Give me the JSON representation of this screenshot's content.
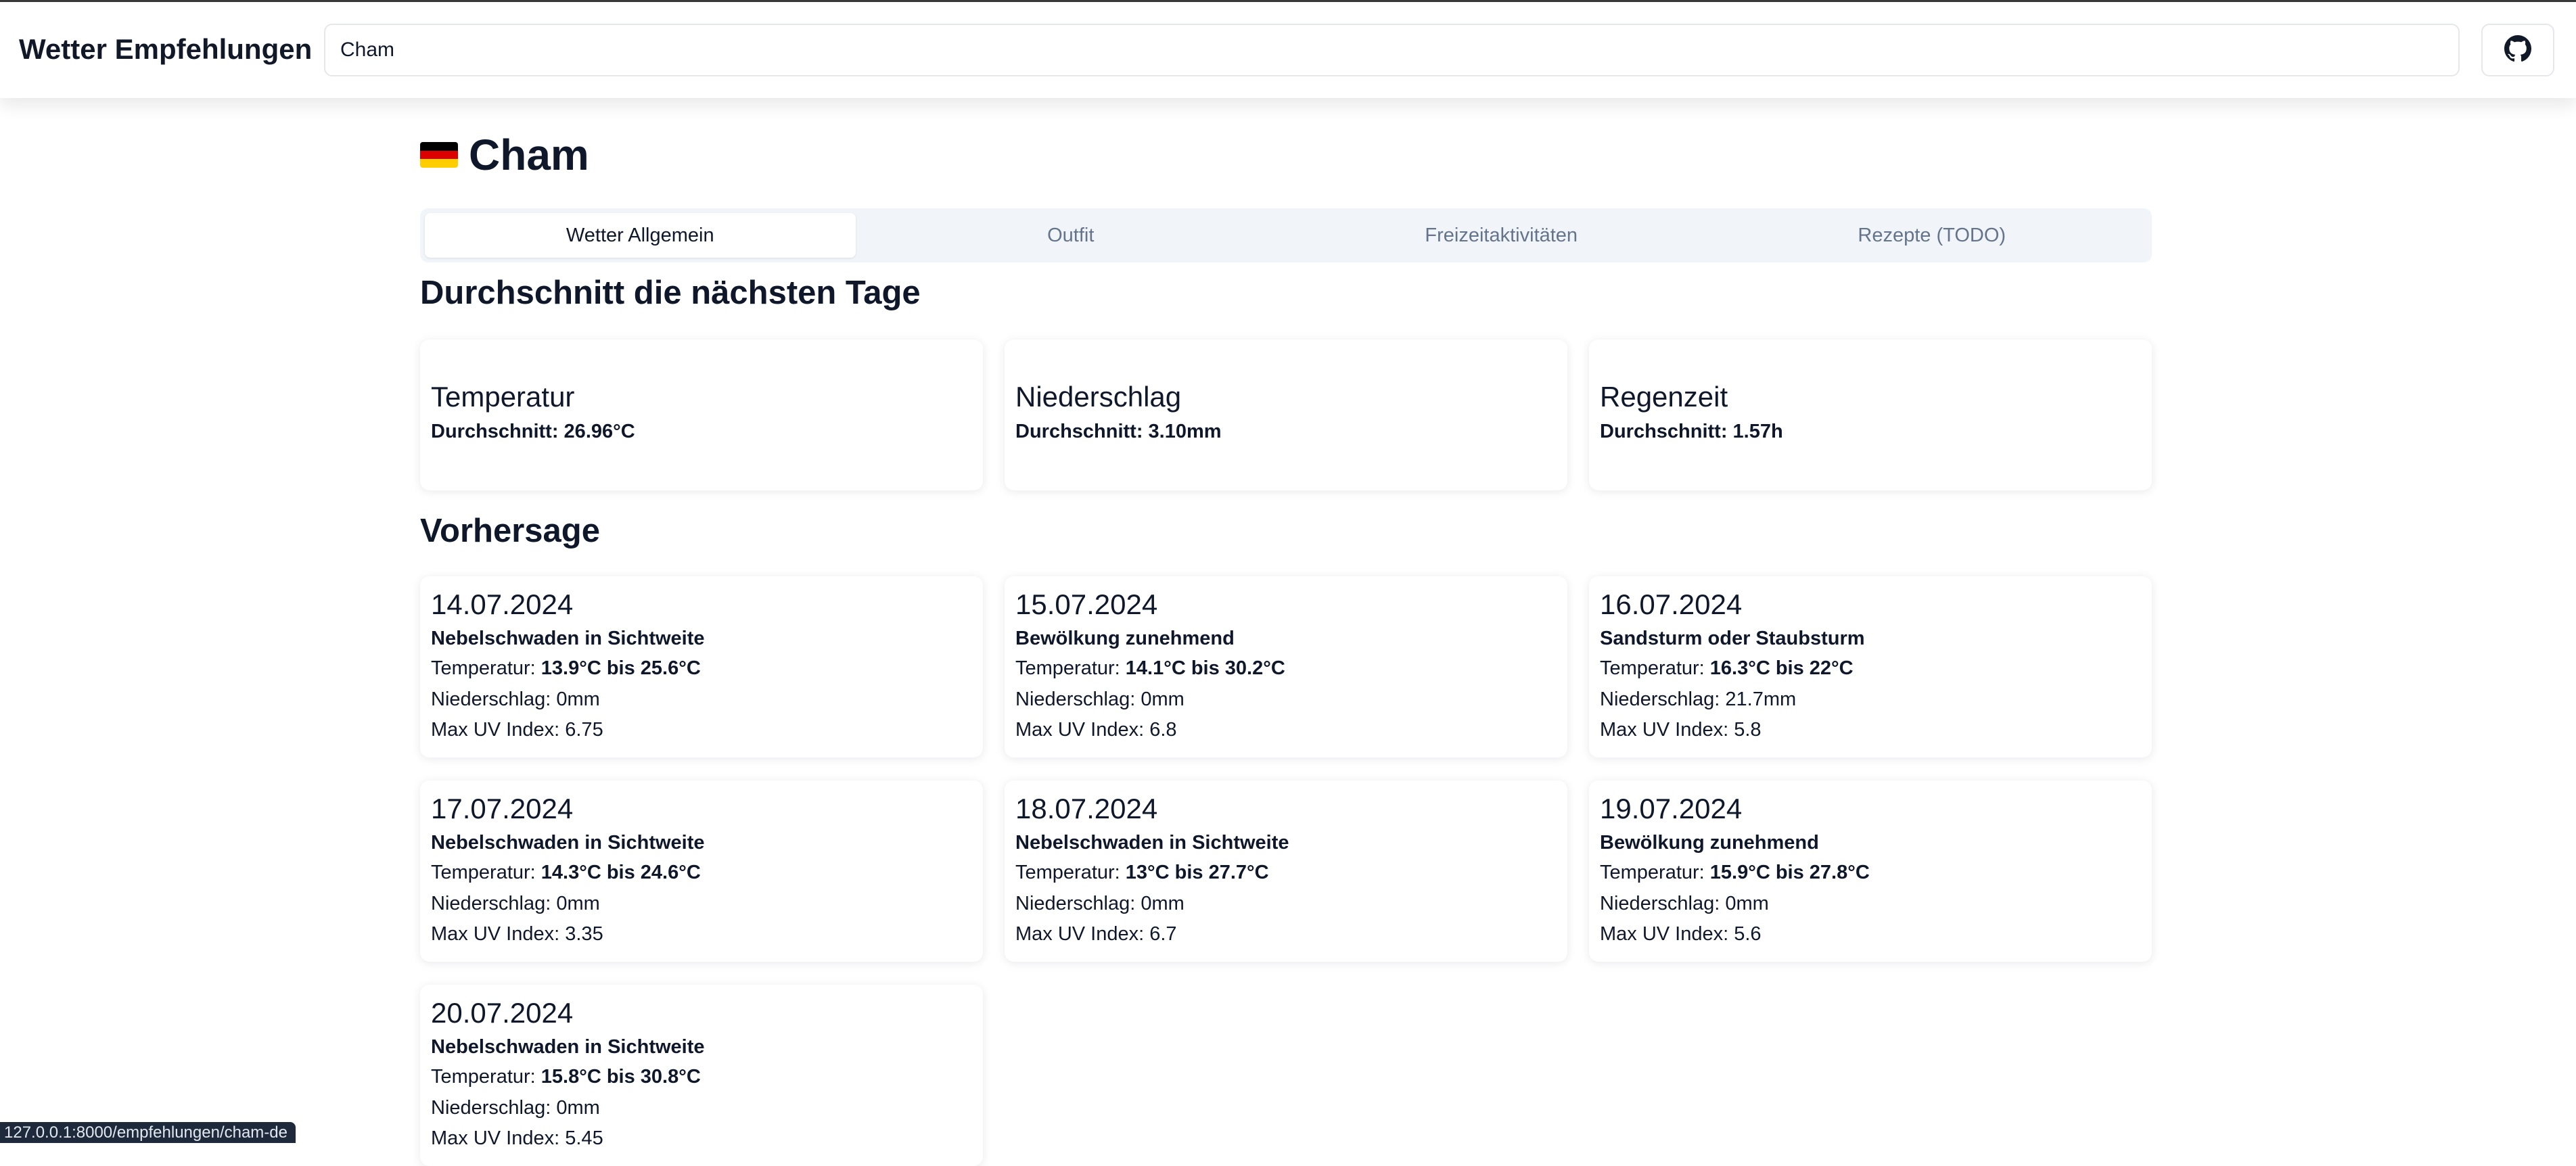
{
  "header": {
    "title": "Wetter Empfehlungen",
    "search_value": "Cham",
    "github_icon": "github-icon"
  },
  "page": {
    "flag": "de-flag-icon",
    "city": "Cham"
  },
  "tabs": [
    {
      "label": "Wetter Allgemein",
      "active": true
    },
    {
      "label": "Outfit",
      "active": false
    },
    {
      "label": "Freizeitaktivitäten",
      "active": false
    },
    {
      "label": "Rezepte (TODO)",
      "active": false
    }
  ],
  "averages": {
    "heading": "Durchschnitt die nächsten Tage",
    "cards": [
      {
        "title": "Temperatur",
        "value": "Durchschnitt: 26.96°C"
      },
      {
        "title": "Niederschlag",
        "value": "Durchschnitt: 3.10mm"
      },
      {
        "title": "Regenzeit",
        "value": "Durchschnitt: 1.57h"
      }
    ]
  },
  "forecast": {
    "heading": "Vorhersage",
    "temp_label": "Temperatur: ",
    "precip_label": "Niederschlag: ",
    "uv_label": "Max UV Index: ",
    "days": [
      {
        "date": "14.07.2024",
        "desc": "Nebelschwaden in Sichtweite",
        "temp": "13.9°C bis 25.6°C",
        "precip": "0mm",
        "uv": "6.75"
      },
      {
        "date": "15.07.2024",
        "desc": "Bewölkung zunehmend",
        "temp": "14.1°C bis 30.2°C",
        "precip": "0mm",
        "uv": "6.8"
      },
      {
        "date": "16.07.2024",
        "desc": "Sandsturm oder Staubsturm",
        "temp": "16.3°C bis 22°C",
        "precip": "21.7mm",
        "uv": "5.8"
      },
      {
        "date": "17.07.2024",
        "desc": "Nebelschwaden in Sichtweite",
        "temp": "14.3°C bis 24.6°C",
        "precip": "0mm",
        "uv": "3.35"
      },
      {
        "date": "18.07.2024",
        "desc": "Nebelschwaden in Sichtweite",
        "temp": "13°C bis 27.7°C",
        "precip": "0mm",
        "uv": "6.7"
      },
      {
        "date": "19.07.2024",
        "desc": "Bewölkung zunehmend",
        "temp": "15.9°C bis 27.8°C",
        "precip": "0mm",
        "uv": "5.6"
      },
      {
        "date": "20.07.2024",
        "desc": "Nebelschwaden in Sichtweite",
        "temp": "15.8°C bis 30.8°C",
        "precip": "0mm",
        "uv": "5.45"
      }
    ]
  },
  "statusbar": {
    "url": "127.0.0.1:8000/empfehlungen/cham-de"
  },
  "colors": {
    "flag_black": "#000000",
    "flag_red": "#dd0000",
    "flag_gold": "#ffce00",
    "tab_bg": "#f1f5f9"
  }
}
